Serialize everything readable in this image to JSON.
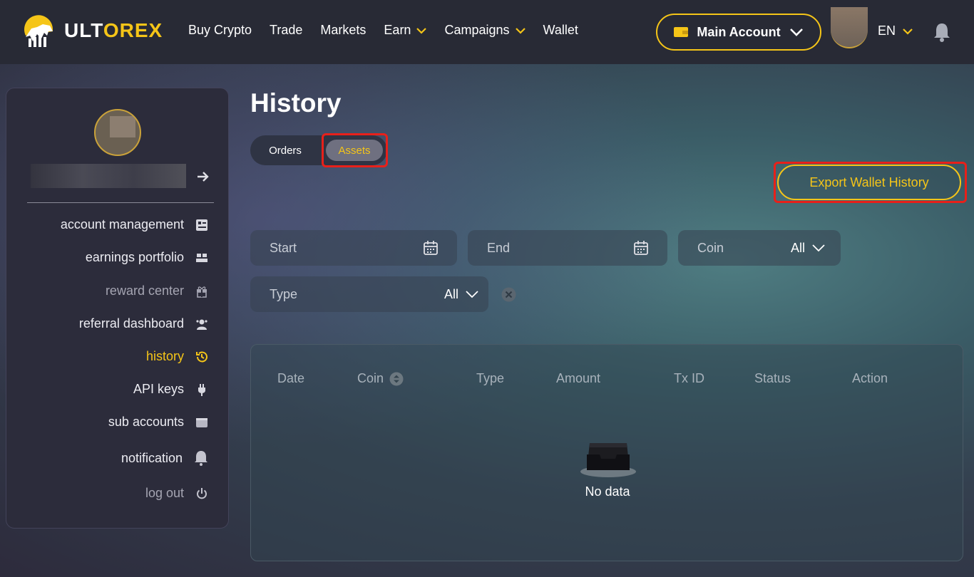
{
  "brand": {
    "name_part1": "ULT",
    "name_part2": "OREX"
  },
  "nav": {
    "items": [
      {
        "label": "Buy Crypto"
      },
      {
        "label": "Trade"
      },
      {
        "label": "Markets"
      },
      {
        "label": "Earn"
      },
      {
        "label": "Campaigns"
      },
      {
        "label": "Wallet"
      }
    ],
    "account_label": "Main Account",
    "language": "EN"
  },
  "sidebar": {
    "items": [
      {
        "label": "account management",
        "icon": "account-management-icon"
      },
      {
        "label": "earnings portfolio",
        "icon": "earnings-portfolio-icon"
      },
      {
        "label": "reward center",
        "icon": "gift-icon"
      },
      {
        "label": "referral dashboard",
        "icon": "referral-icon"
      },
      {
        "label": "history",
        "icon": "history-icon"
      },
      {
        "label": "API keys",
        "icon": "plug-icon"
      },
      {
        "label": "sub accounts",
        "icon": "wallet-icon"
      },
      {
        "label": "notification",
        "icon": "bell-icon"
      },
      {
        "label": "log out",
        "icon": "power-icon"
      }
    ],
    "active": "history"
  },
  "page": {
    "title": "History",
    "tabs": {
      "orders": "Orders",
      "assets": "Assets",
      "active": "Assets"
    },
    "export_label": "Export Wallet History"
  },
  "filters": {
    "start_placeholder": "Start",
    "end_placeholder": "End",
    "coin_label": "Coin",
    "coin_value": "All",
    "type_label": "Type",
    "type_value": "All"
  },
  "table": {
    "columns": [
      "Date",
      "Coin",
      "Type",
      "Amount",
      "Tx ID",
      "Status",
      "Action"
    ],
    "rows": [],
    "empty_text": "No data"
  },
  "colors": {
    "accent": "#f5c518",
    "highlight": "#e8201a"
  }
}
